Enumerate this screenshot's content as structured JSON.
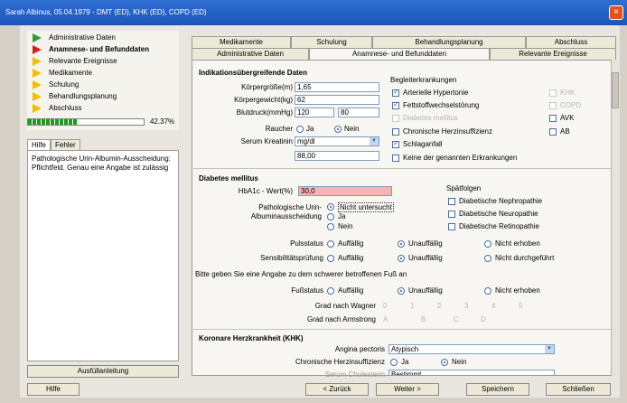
{
  "window": {
    "title": "Sarah Albinus, 05.04.1979 - DMT (ED), KHK (ED), COPD (ED)",
    "close": "×"
  },
  "nav": {
    "items": [
      {
        "label": "Administrative Daten",
        "state": "done"
      },
      {
        "label": "Anamnese- und Befunddaten",
        "state": "current"
      },
      {
        "label": "Relevante Ereignisse",
        "state": "open"
      },
      {
        "label": "Medikamente",
        "state": "open"
      },
      {
        "label": "Schulung",
        "state": "open"
      },
      {
        "label": "Behandlungsplanung",
        "state": "open"
      },
      {
        "label": "Abschluss",
        "state": "open"
      }
    ],
    "progress": 0.4237,
    "progress_label": "42.37%"
  },
  "help": {
    "tabs": [
      "Hilfe",
      "Fehler"
    ],
    "text": "Pathologische Urin-Albumin-Ausscheidung: Pflichtfeld. Genau eine Angabe ist zulässig",
    "guide_button": "Ausfüllanleitung"
  },
  "tabs_top": [
    "Medikamente",
    "Schulung",
    "Behandlungsplanung",
    "Abschluss"
  ],
  "tabs_bottom": [
    "Administrative Daten",
    "Anamnese- und Befunddaten",
    "Relevante Ereignisse"
  ],
  "section1": {
    "title": "Indikationsübergreifende Daten",
    "height_label": "Körpergröße(m)",
    "height": "1,65",
    "weight_label": "Körpergewicht(kg)",
    "weight": "62",
    "bp_label": "Blutdruck(mmHg)",
    "bp_sys": "120",
    "bp_dia": "80",
    "smoker_label": "Raucher",
    "smoker_yes": "Ja",
    "smoker_no": "Nein",
    "creat_label": "Serum Kreatinin",
    "creat_unit": "mg/dl",
    "creat_value": "88,00"
  },
  "comorbidities": {
    "title": "Begleiterkrankungen",
    "items": [
      {
        "label": "Arterielle Hypertonie",
        "checked": true,
        "disabled": false
      },
      {
        "label": "Fettstoffwechselstörung",
        "checked": true,
        "disabled": false
      },
      {
        "label": "Diabetes mellitus",
        "checked": false,
        "disabled": true
      },
      {
        "label": "Chronische Herzinsuffizienz",
        "checked": false,
        "disabled": false
      },
      {
        "label": "Schlaganfall",
        "checked": true,
        "disabled": false
      },
      {
        "label": "Keine der genannten Erkrankungen",
        "checked": false,
        "disabled": false
      }
    ],
    "side": [
      {
        "label": "KHK",
        "checked": false,
        "disabled": true
      },
      {
        "label": "COPD",
        "checked": false,
        "disabled": true
      },
      {
        "label": "AVK",
        "checked": false,
        "disabled": false
      },
      {
        "label": "AB",
        "checked": false,
        "disabled": false
      }
    ]
  },
  "diabetes": {
    "title": "Diabetes mellitus",
    "hba1c_label": "HbA1c - Wert(%)",
    "hba1c": "30,0",
    "urine_label_1": "Pathologische Urin-",
    "urine_label_2": "Albuminausscheidung",
    "urine_options": [
      "Nicht untersucht",
      "Ja",
      "Nein"
    ],
    "late_title": "Spätfolgen",
    "late_items": [
      "Diabetische Nephropathie",
      "Diabetische Neuropathie",
      "Diabetische Retinopathie"
    ],
    "pulse_label": "Pulsstatus",
    "sens_label": "Sensibilitätsprüfung",
    "status_options": [
      "Auffällig",
      "Unauffällig",
      "Nicht erhoben",
      "Nicht durchgeführt"
    ],
    "foot_prompt": "Bitte geben Sie eine Angabe zu dem schwerer betroffenen Fuß an",
    "foot_label": "Fußstatus",
    "wagner_label": "Grad nach Wagner",
    "wagner_values": [
      "0",
      "1",
      "2",
      "3",
      "4",
      "5"
    ],
    "armstrong_label": "Grad nach Armstrong",
    "armstrong_values": [
      "A",
      "B",
      "C",
      "D"
    ]
  },
  "khk": {
    "title": "Koronare Herzkrankheit (KHK)",
    "angina_label": "Angina pectoris",
    "angina_value": "Atypisch",
    "chi_label": "Chronische Herzinsuffizienz",
    "chi_yes": "Ja",
    "chi_no": "Nein",
    "cut_label": "Serum Cholesterin",
    "cut_value": "Bestimmt"
  },
  "bottom": {
    "help": "Hilfe",
    "back": "< Zurück",
    "next": "Weiter >",
    "save": "Speichern",
    "close": "Schließen"
  }
}
